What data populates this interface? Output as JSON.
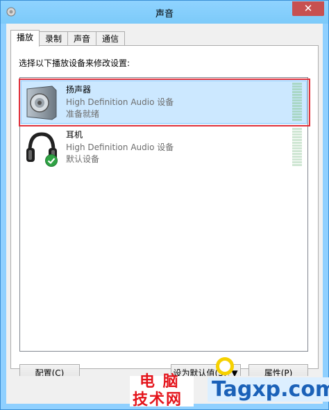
{
  "window": {
    "title": "声音",
    "close_label": "✕"
  },
  "tabs": [
    {
      "label": "播放",
      "active": true
    },
    {
      "label": "录制",
      "active": false
    },
    {
      "label": "声音",
      "active": false
    },
    {
      "label": "通信",
      "active": false
    }
  ],
  "instruction": "选择以下播放设备来修改设置:",
  "devices": [
    {
      "name": "扬声器",
      "description": "High Definition Audio 设备",
      "status": "准备就绪",
      "icon": "speaker-icon",
      "selected": true
    },
    {
      "name": "耳机",
      "description": "High Definition Audio 设备",
      "status": "默认设备",
      "icon": "headphones-icon",
      "badge": "green-check-icon",
      "selected": false
    }
  ],
  "buttons": {
    "configure": "配置(C)",
    "set_default": "设为默认值(S)",
    "set_default_arrow": "▼",
    "properties": "属性(P)"
  },
  "watermark": {
    "cn_line1": "电 脑",
    "cn_line2": "技术网",
    "en": "Tagxp.com"
  },
  "colors": {
    "titlebar": "#8fd3ff",
    "selection": "#cce8ff",
    "highlight_box": "#e0303a",
    "watermark_red": "#e4141b",
    "watermark_blue": "#1a61b8"
  }
}
